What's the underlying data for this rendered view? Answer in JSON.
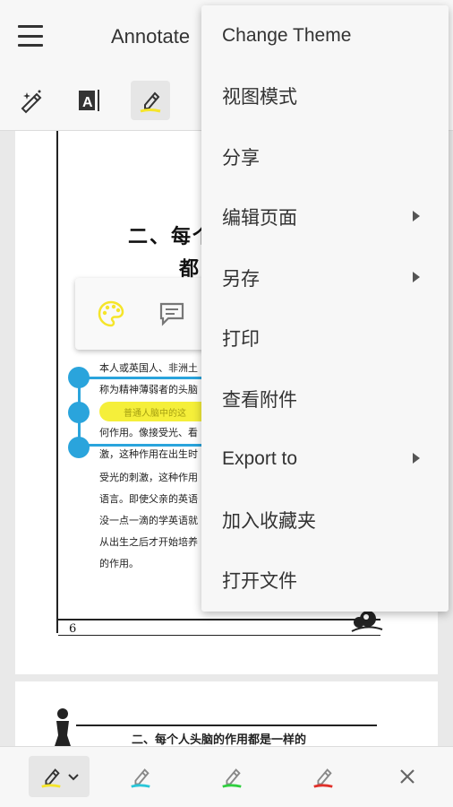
{
  "appbar": {
    "title": "Annotate",
    "tools": [
      {
        "name": "auto-annotate-icon"
      },
      {
        "name": "text-select-icon"
      },
      {
        "name": "highlighter-icon",
        "active": true
      }
    ]
  },
  "document": {
    "heading_line1": "二、每个",
    "heading_line2": "都",
    "lines": [
      "本人或英国人、非洲土",
      "称为精神薄弱者的头脑",
      "何作用。像接受光、看",
      "激，这种作用在出生时",
      "受光的刺激，这种作用",
      "语言。即使父亲的英语",
      "没一点一滴的学英语就",
      "从出生之后才开始培养",
      "的作用。"
    ],
    "highlighted_text": "普通人脑中的这",
    "page_number": "6",
    "page2_heading": "二、每个人头脑的作用都是一样的"
  },
  "popup": {
    "buttons": [
      "palette-icon",
      "comment-icon"
    ],
    "palette_color": "#f5e52a"
  },
  "menu": {
    "items": [
      {
        "label": "Change Theme",
        "submenu": false
      },
      {
        "label": "视图模式",
        "submenu": false
      },
      {
        "label": "分享",
        "submenu": false
      },
      {
        "label": "编辑页面",
        "submenu": true
      },
      {
        "label": "另存",
        "submenu": true
      },
      {
        "label": "打印",
        "submenu": false
      },
      {
        "label": "查看附件",
        "submenu": false
      },
      {
        "label": "Export to",
        "submenu": true
      },
      {
        "label": "加入收藏夹",
        "submenu": false
      },
      {
        "label": "打开文件",
        "submenu": false
      }
    ]
  },
  "bottombar": {
    "pens": [
      {
        "name": "yellow-highlighter",
        "color": "#f5e52a",
        "active": true
      },
      {
        "name": "cyan-highlighter",
        "color": "#29c6d8"
      },
      {
        "name": "green-highlighter",
        "color": "#2fcf3f"
      },
      {
        "name": "red-highlighter",
        "color": "#e0302a"
      }
    ],
    "close_icon": "close-icon"
  },
  "colors": {
    "accent": "#2aa4dc",
    "highlight": "#f5ef3a"
  }
}
